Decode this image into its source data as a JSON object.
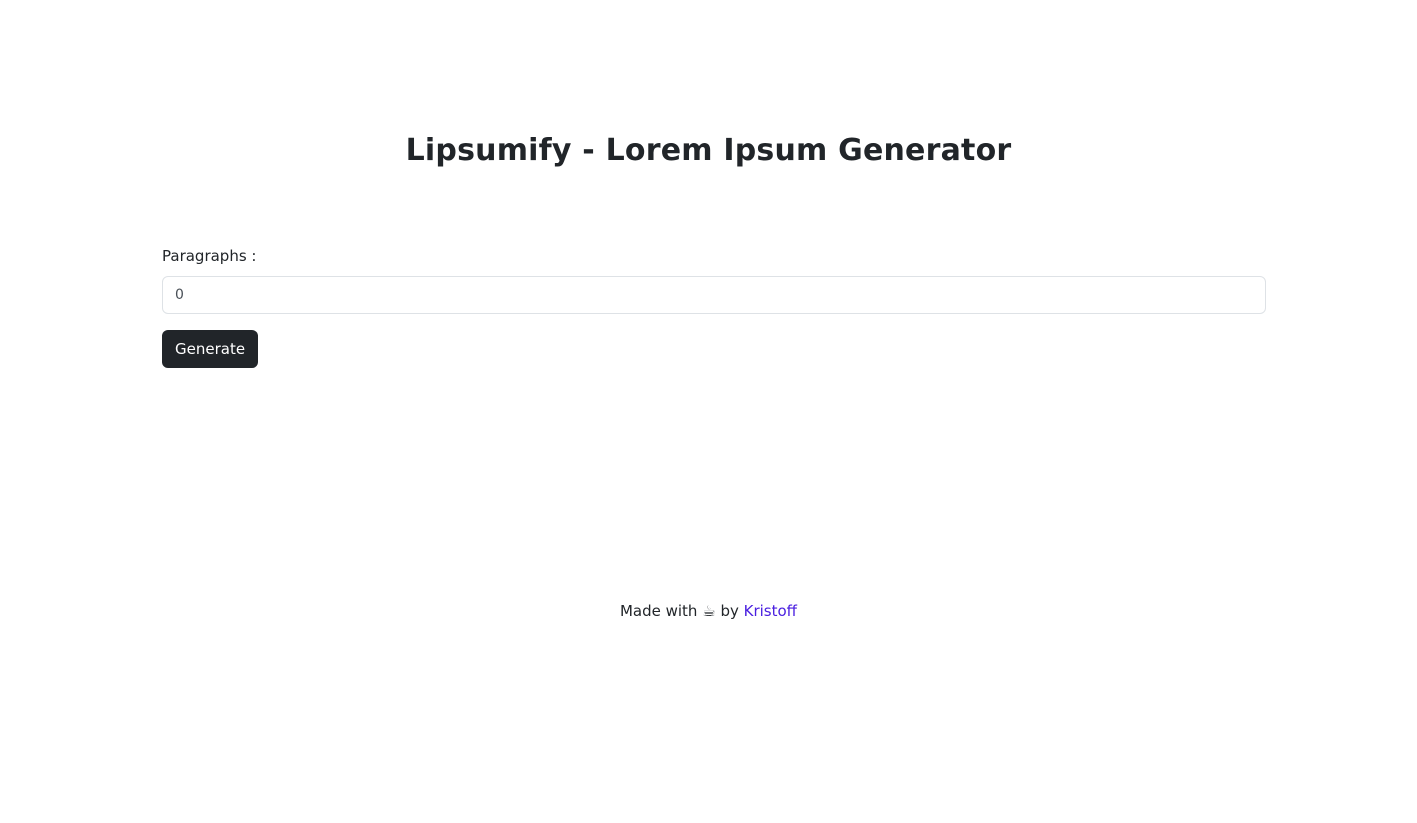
{
  "header": {
    "title": "Lipsumify - Lorem Ipsum Generator"
  },
  "form": {
    "label": "Paragraphs :",
    "input_value": "0",
    "button_label": "Generate"
  },
  "footer": {
    "prefix": "Made with",
    "icon": "coffee-icon",
    "icon_glyph": "☕",
    "by": "by",
    "author": "Kristoff",
    "link_color": "#4a1fe0"
  },
  "colors": {
    "text": "#212529",
    "button_bg": "#212529",
    "button_text": "#ffffff",
    "input_border": "#dee2e6"
  }
}
